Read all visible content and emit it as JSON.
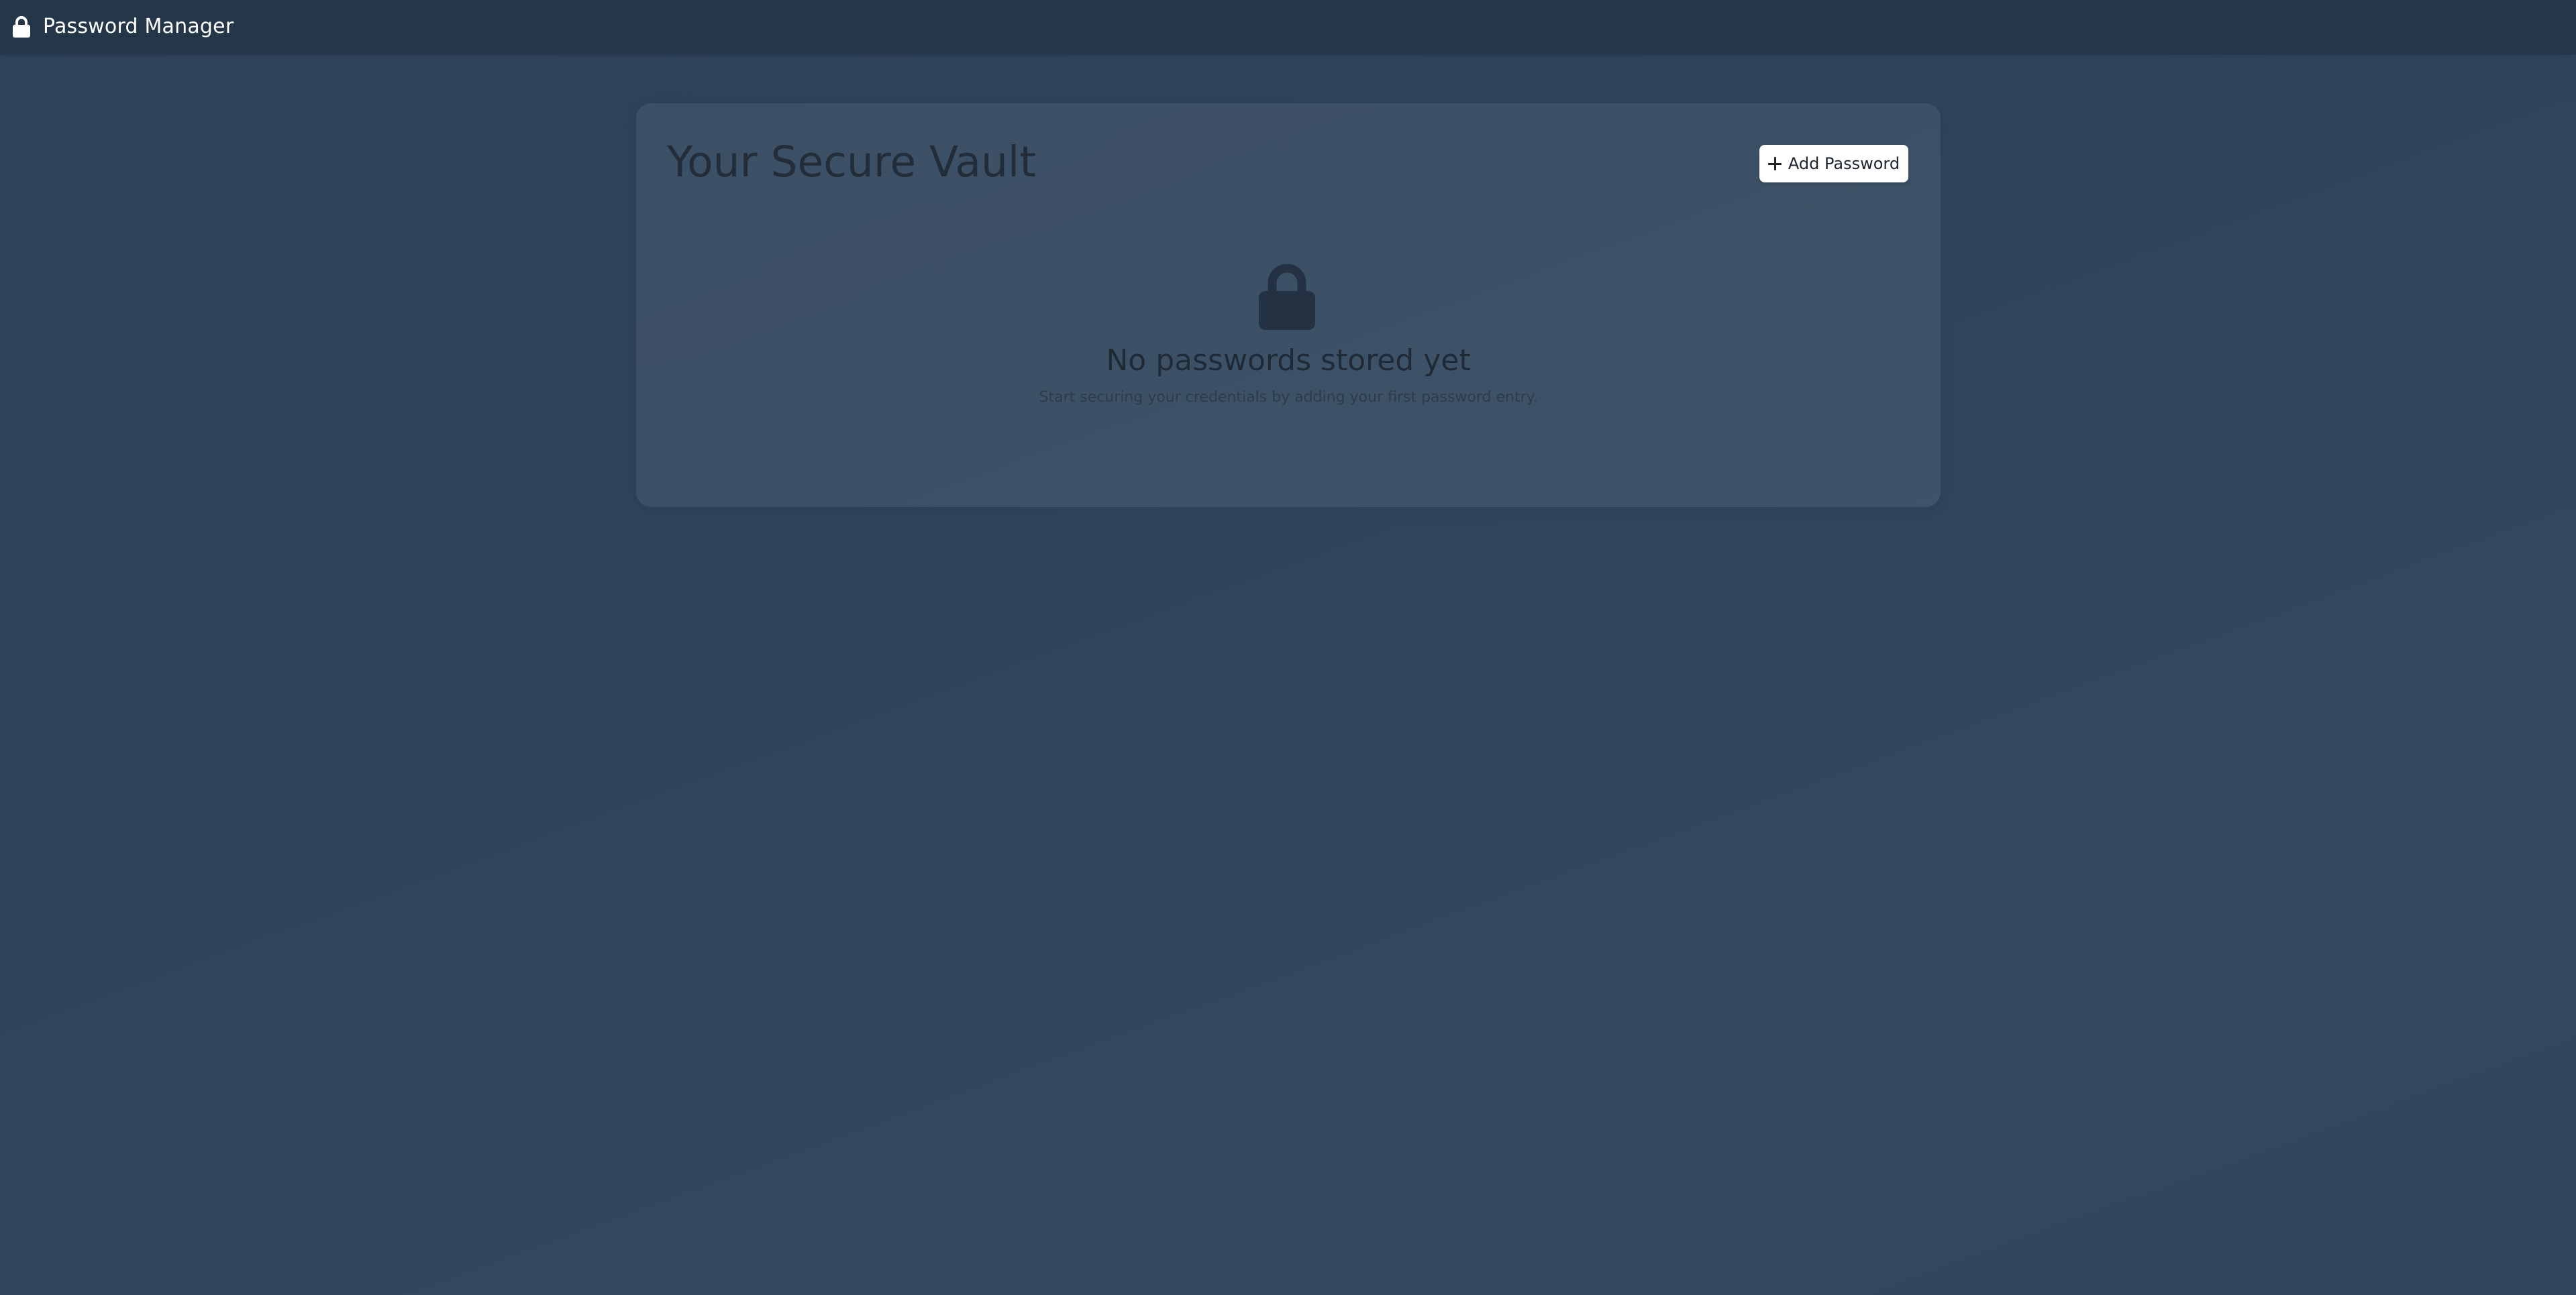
{
  "app": {
    "title": "Password Manager",
    "brand_icon": "lock-icon"
  },
  "vault": {
    "heading": "Your Secure Vault",
    "add_button_label": "Add Password",
    "add_button_icon": "plus-icon"
  },
  "empty_state": {
    "icon": "lock-icon",
    "title": "No passwords stored yet",
    "subtitle": "Start securing your credentials by adding your first password entry."
  },
  "colors": {
    "background": "#2f445b",
    "topbar": "#263649",
    "button_background": "#ffffff",
    "text_dark": "#222d39"
  }
}
